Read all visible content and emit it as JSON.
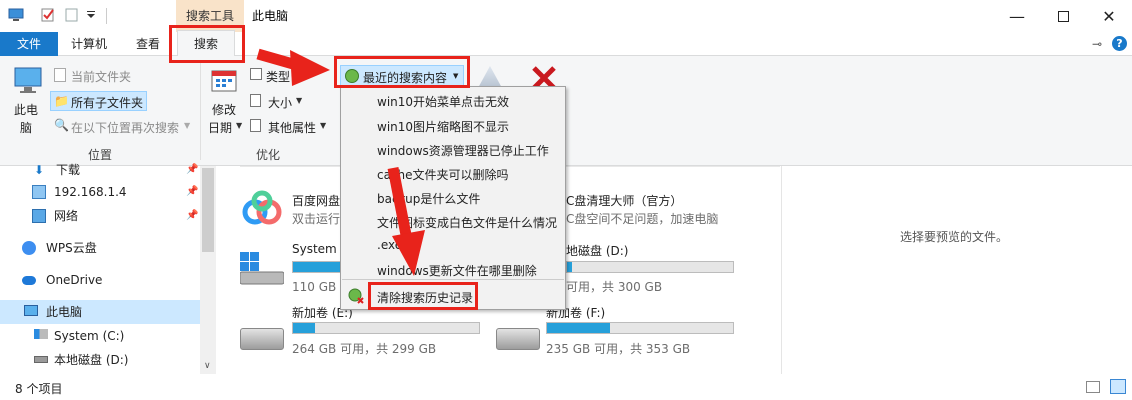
{
  "window": {
    "title": "此电脑",
    "context_tab": "搜索工具"
  },
  "tabs": {
    "file": "文件",
    "computer": "计算机",
    "view": "查看",
    "search": "搜索"
  },
  "ribbon": {
    "location": {
      "this_pc_line1": "此电",
      "this_pc_line2": "脑",
      "current_folder": "当前文件夹",
      "all_subfolders": "所有子文件夹",
      "search_again_in": "在以下位置再次搜索",
      "group_label": "位置"
    },
    "refine": {
      "date_modified_line1": "修改",
      "date_modified_line2": "日期",
      "kind": "类型",
      "size": "大小",
      "other_properties": "其他属性",
      "group_label": "优化"
    },
    "recent_searches": "最近的搜索内容"
  },
  "dropdown": {
    "items": [
      "win10开始菜单点击无效",
      "win10图片缩略图不显示",
      "windows资源管理器已停止工作",
      "cache文件夹可以删除吗",
      "backup是什么文件",
      "文件图标变成白色文件是什么情况",
      ".exe",
      "windows更新文件在哪里删除"
    ],
    "clear_history": "清除搜索历史记录"
  },
  "nav": {
    "items": [
      {
        "label": "下载",
        "pinned": true
      },
      {
        "label": "192.168.1.4",
        "pinned": true
      },
      {
        "label": "网络",
        "pinned": true
      },
      {
        "label": "WPS云盘",
        "pinned": false
      },
      {
        "label": "OneDrive",
        "pinned": false
      },
      {
        "label": "此电脑",
        "pinned": false,
        "selected": true
      },
      {
        "label": "System (C:)",
        "pinned": false
      },
      {
        "label": "本地磁盘 (D:)",
        "pinned": false
      }
    ]
  },
  "content": {
    "apps": [
      {
        "name": "百度网盘",
        "desc": "双击运行"
      },
      {
        "name": "C盘清理大师（官方）",
        "desc": "C盘空间不足问题，加速电脑"
      }
    ],
    "drives": [
      {
        "name": "System (",
        "free": "110 GB 可用,",
        "used_fraction": 0.2
      },
      {
        "name": "地磁盘 (D:)",
        "free": "可用，共 300 GB",
        "used_fraction": 0.05
      },
      {
        "name": "新加卷 (E:)",
        "free": "264 GB 可用，共 299 GB",
        "used_fraction": 0.12
      },
      {
        "name": "新加卷 (F:)",
        "free": "235 GB 可用，共 353 GB",
        "used_fraction": 0.34
      }
    ]
  },
  "preview": {
    "text": "选择要预览的文件。"
  },
  "status": {
    "count": "8 个项目"
  },
  "colors": {
    "accent": "#1979ca",
    "highlight_red": "#e8231b",
    "progress": "#26a0da",
    "context_tab": "#f9e3c9"
  }
}
